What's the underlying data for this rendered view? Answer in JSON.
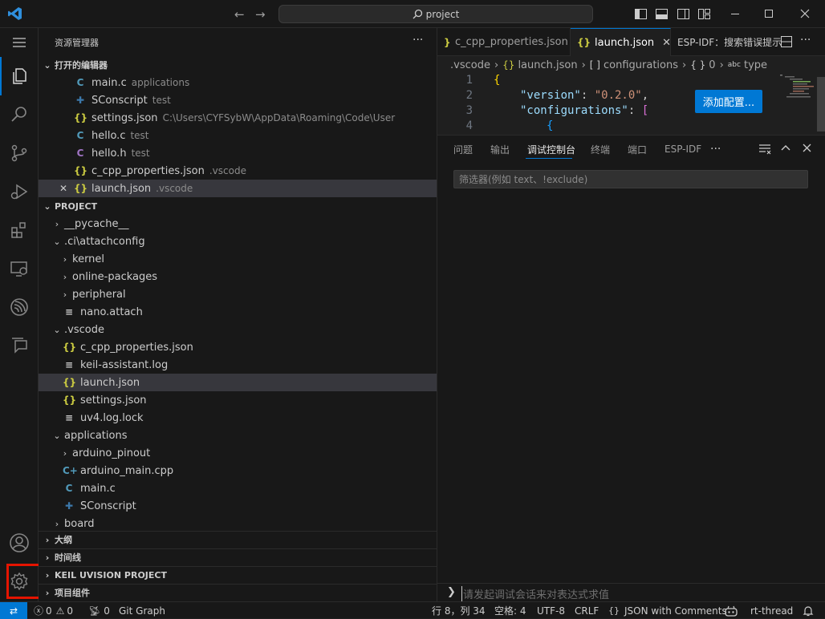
{
  "window": {
    "search_text": "project"
  },
  "sidebar": {
    "title": "资源管理器",
    "more": "···",
    "open_editors": {
      "header": "打开的编辑器",
      "items": [
        {
          "icon": "C",
          "name": "main.c",
          "desc": "applications"
        },
        {
          "icon": "py",
          "name": "SConscript",
          "desc": "test"
        },
        {
          "icon": "{}",
          "name": "settings.json",
          "desc": "C:\\Users\\CYFSybW\\AppData\\Roaming\\Code\\User"
        },
        {
          "icon": "C",
          "name": "hello.c",
          "desc": "test"
        },
        {
          "icon": "C",
          "name": "hello.h",
          "desc": "test"
        },
        {
          "icon": "{}",
          "name": "c_cpp_properties.json",
          "desc": ".vscode"
        },
        {
          "icon": "{}",
          "name": "launch.json",
          "desc": ".vscode",
          "close": "✕"
        }
      ]
    },
    "project": {
      "header": "PROJECT",
      "tree": [
        {
          "kind": "folder",
          "depth": 1,
          "open": false,
          "name": "__pycache__"
        },
        {
          "kind": "folder",
          "depth": 1,
          "open": true,
          "name": ".ci\\attachconfig"
        },
        {
          "kind": "folder",
          "depth": 2,
          "open": false,
          "name": "kernel"
        },
        {
          "kind": "folder",
          "depth": 2,
          "open": false,
          "name": "online-packages"
        },
        {
          "kind": "folder",
          "depth": 2,
          "open": false,
          "name": "peripheral"
        },
        {
          "kind": "file",
          "depth": 2,
          "icon": "≡",
          "name": "nano.attach"
        },
        {
          "kind": "folder",
          "depth": 1,
          "open": true,
          "name": ".vscode"
        },
        {
          "kind": "file",
          "depth": 2,
          "icon": "{}",
          "name": "c_cpp_properties.json"
        },
        {
          "kind": "file",
          "depth": 2,
          "icon": "≡",
          "name": "keil-assistant.log"
        },
        {
          "kind": "file",
          "depth": 2,
          "icon": "{}",
          "name": "launch.json",
          "selected": true
        },
        {
          "kind": "file",
          "depth": 2,
          "icon": "{}",
          "name": "settings.json"
        },
        {
          "kind": "file",
          "depth": 2,
          "icon": "≡",
          "name": "uv4.log.lock"
        },
        {
          "kind": "folder",
          "depth": 1,
          "open": true,
          "name": "applications"
        },
        {
          "kind": "folder",
          "depth": 2,
          "open": false,
          "name": "arduino_pinout"
        },
        {
          "kind": "file",
          "depth": 2,
          "icon": "C+",
          "name": "arduino_main.cpp"
        },
        {
          "kind": "file",
          "depth": 2,
          "icon": "C",
          "name": "main.c"
        },
        {
          "kind": "file",
          "depth": 2,
          "icon": "py",
          "name": "SConscript"
        },
        {
          "kind": "folder",
          "depth": 1,
          "open": false,
          "name": "board"
        }
      ]
    },
    "sections": [
      "大纲",
      "时间线",
      "KEIL UVISION PROJECT",
      "项目组件"
    ]
  },
  "tabs": [
    {
      "icon": "}",
      "label": "c_cpp_properties.json",
      "active": false
    },
    {
      "icon": "{}",
      "label": "launch.json",
      "active": true,
      "close": "✕"
    },
    {
      "icon": "",
      "label": "ESP-IDF：搜索错误提示",
      "active": false
    }
  ],
  "breadcrumb": [
    ".vscode",
    "launch.json",
    "configurations",
    "0",
    "type"
  ],
  "breadcrumb_icons": [
    "",
    "{}",
    "[ ]",
    "{ }",
    "abc"
  ],
  "editor": {
    "lines": [
      {
        "n": "1",
        "text": "{"
      },
      {
        "n": "2",
        "key": "\"version\"",
        "val": "\"0.2.0\""
      },
      {
        "n": "3",
        "key": "\"configurations\"",
        "val": "["
      },
      {
        "n": "4",
        "text": "{"
      }
    ],
    "add_config_button": "添加配置..."
  },
  "panel": {
    "tabs": [
      "问题",
      "输出",
      "调试控制台",
      "终端",
      "端口",
      "ESP-IDF"
    ],
    "active_tab": "调试控制台",
    "more": "···",
    "filter_placeholder": "筛选器(例如 text、!exclude)",
    "repl_placeholder": "请发起调试会话来对表达式求值"
  },
  "status": {
    "remote": "⇄",
    "errors": "0",
    "warnings": "0",
    "ports": "0",
    "git_graph": "Git Graph",
    "position": "行 8，列 34",
    "spaces": "空格: 4",
    "encoding": "UTF-8",
    "eol": "CRLF",
    "language": "JSON with Comments",
    "rtthread": "rt-thread"
  },
  "colors": {
    "accent": "#0078d4",
    "highlight_box": "#e51400",
    "json_key": "#9cdcfe",
    "json_string": "#ce9178",
    "bracket_yellow": "#ffd700",
    "bracket_pink": "#da70d6",
    "bracket_blue": "#179fff"
  }
}
